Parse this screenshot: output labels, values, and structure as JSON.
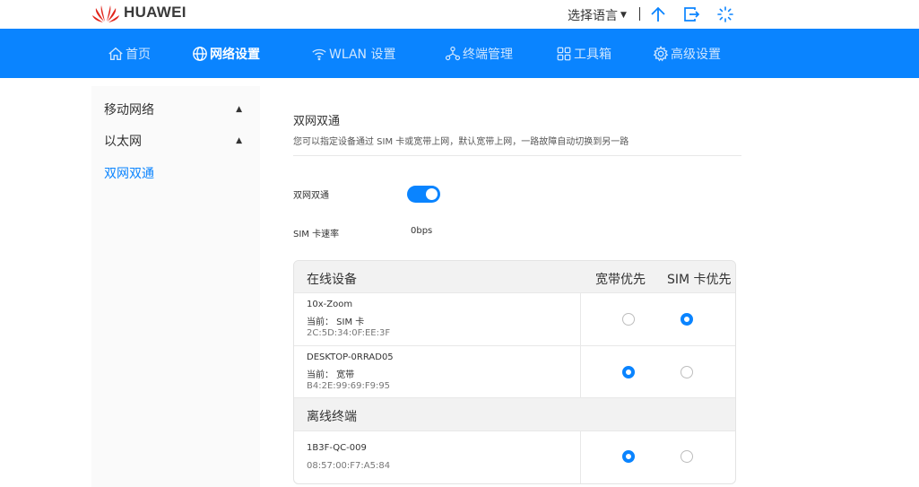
{
  "header": {
    "brand": "HUAWEI",
    "language_label": "选择语言",
    "icons": [
      "upload-icon",
      "logout-icon",
      "loading-icon"
    ]
  },
  "nav": {
    "items": [
      {
        "label": "首页",
        "icon": "home-icon"
      },
      {
        "label": "网络设置",
        "icon": "globe-icon"
      },
      {
        "label": "WLAN 设置",
        "icon": "wifi-icon"
      },
      {
        "label": "终端管理",
        "icon": "devices-icon"
      },
      {
        "label": "工具箱",
        "icon": "toolbox-icon"
      },
      {
        "label": "高级设置",
        "icon": "gear-icon"
      }
    ],
    "active_index": 1
  },
  "sidebar": {
    "items": [
      {
        "label": "移动网络"
      },
      {
        "label": "以太网"
      },
      {
        "label": "双网双通"
      }
    ]
  },
  "main": {
    "title": "双网双通",
    "description": "您可以指定设备通过 SIM 卡或宽带上网，默认宽带上网，一路故障自动切换到另一路",
    "toggle_label": "双网双通",
    "toggle_on": true,
    "sim_rate_label": "SIM 卡速率",
    "sim_rate_value": "0bps"
  },
  "table": {
    "online_header": "在线设备",
    "col_broadband": "宽带优先",
    "col_sim": "SIM 卡优先",
    "offline_header": "离线终端",
    "online_devices": [
      {
        "name": "10x-Zoom",
        "current": "当前： SIM 卡",
        "mac": "2C:5D:34:0F:EE:3F",
        "selected": "sim"
      },
      {
        "name": "DESKTOP-0RRAD05",
        "current": "当前： 宽带",
        "mac": "B4:2E:99:69:F9:95",
        "selected": "broadband"
      }
    ],
    "offline_devices": [
      {
        "name": "1B3F-QC-009",
        "mac": "08:57:00:F7:A5:84",
        "selected": "broadband"
      }
    ]
  },
  "colors": {
    "accent": "#0a84ff",
    "brand_red": "#e1251b"
  }
}
